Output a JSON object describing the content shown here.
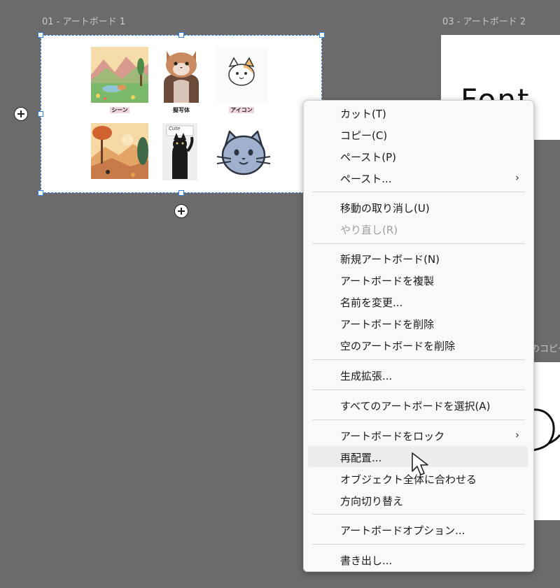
{
  "artboards": [
    {
      "label": "01 - アートボード 1"
    },
    {
      "label": "03 - アートボード 2"
    },
    {
      "label": "のコピー"
    }
  ],
  "artboard2": {
    "text": "Font"
  },
  "thumbnails": {
    "captions": [
      "シーン",
      "擬写体",
      "アイコン"
    ],
    "cat_sign": "Cute"
  },
  "context_menu": {
    "groups": [
      [
        {
          "label": "カット(T)"
        },
        {
          "label": "コピー(C)"
        },
        {
          "label": "ペースト(P)"
        },
        {
          "label": "ペースト...",
          "submenu": "›"
        }
      ],
      [
        {
          "label": "移動の取り消し(U)"
        },
        {
          "label": "やり直し(R)",
          "disabled": true
        }
      ],
      [
        {
          "label": "新規アートボード(N)"
        },
        {
          "label": "アートボードを複製"
        },
        {
          "label": "名前を変更..."
        },
        {
          "label": "アートボードを削除"
        },
        {
          "label": "空のアートボードを削除"
        }
      ],
      [
        {
          "label": "生成拡張..."
        }
      ],
      [
        {
          "label": "すべてのアートボードを選択(A)"
        }
      ],
      [
        {
          "label": "アートボードをロック",
          "submenu": "›"
        },
        {
          "label": "再配置...",
          "hovered": true
        },
        {
          "label": "オブジェクト全体に合わせる"
        },
        {
          "label": "方向切り替え"
        }
      ],
      [
        {
          "label": "アートボードオプション..."
        }
      ],
      [
        {
          "label": "書き出し..."
        }
      ]
    ]
  },
  "colors": {
    "canvas": "#6b6b6b",
    "selection": "#2f80ed",
    "menu_bg": "#f9f9f9"
  }
}
